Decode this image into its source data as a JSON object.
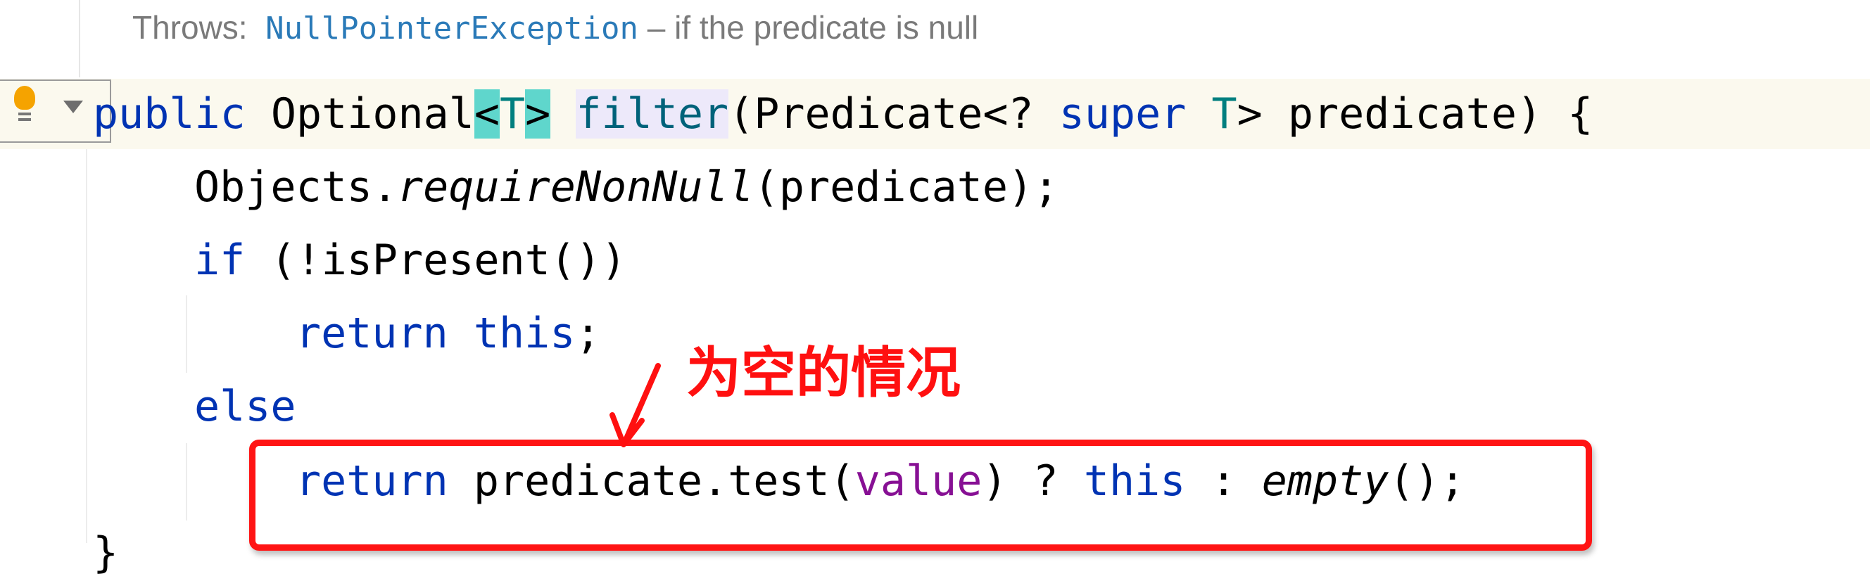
{
  "doc": {
    "throws_label": "Throws:",
    "throws_exception": "NullPointerException",
    "throws_desc": " – if the predicate is null"
  },
  "code": {
    "l1": {
      "kw": "public",
      "type": " Optional",
      "lt": "<",
      "T": "T",
      "gt": ">",
      "fn": "filter",
      "p1": "(Predicate<? ",
      "super": "super",
      "p2": " ",
      "T2": "T",
      "p3": "> predicate) {"
    },
    "l2": {
      "a": "Objects.",
      "b": "requireNonNull",
      "c": "(predicate);"
    },
    "l3": {
      "kw": "if",
      "rest": " (!isPresent())"
    },
    "l4": {
      "kw": "return",
      "sp": " ",
      "this": "this",
      "end": ";"
    },
    "l5": {
      "kw": "else"
    },
    "l6": {
      "kw": "return",
      "a": " predicate.test(",
      "val": "value",
      "b": ") ? ",
      "this": "this",
      "c": " : ",
      "empty": "empty",
      "d": "();"
    },
    "l7": {
      "brace": "}"
    }
  },
  "annotation": {
    "text": "为空的情况",
    "color": "#ff1010"
  },
  "icons": {
    "intention": "lightbulb-icon",
    "menu": "chevron-down-icon"
  },
  "colors": {
    "keyword": "#0033b3",
    "field": "#871094",
    "highlight_box": "#ff1414"
  }
}
